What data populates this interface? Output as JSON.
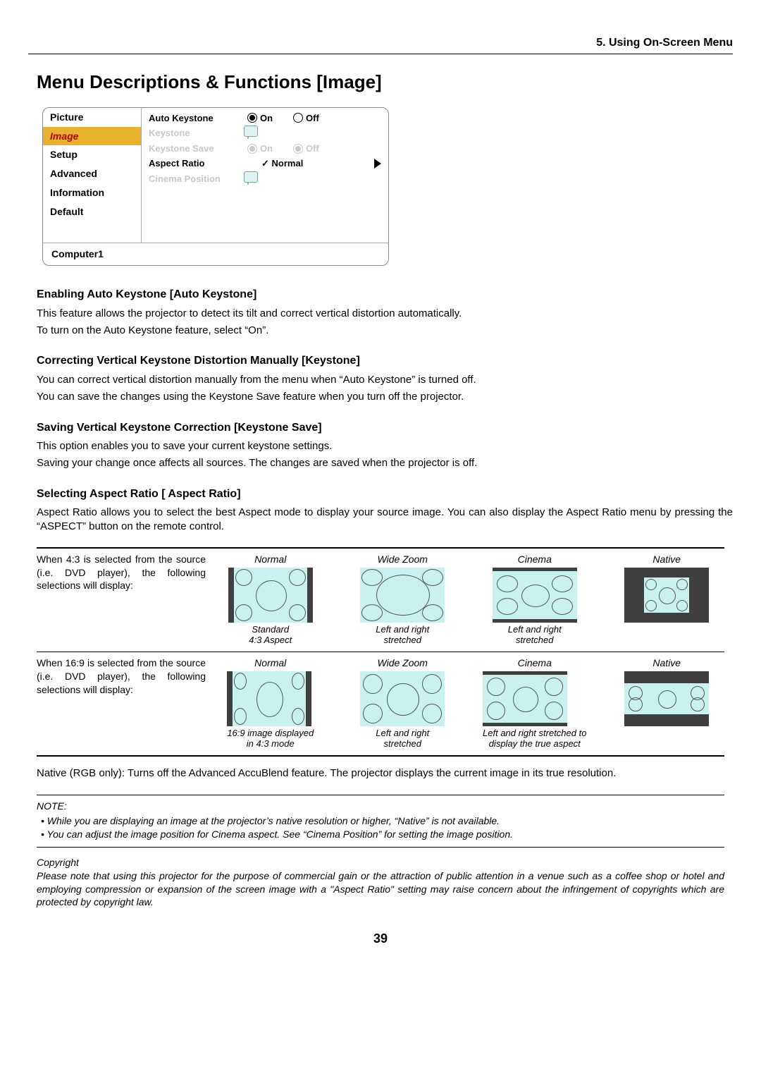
{
  "chapter": "5. Using On-Screen Menu",
  "title": "Menu Descriptions & Functions [Image]",
  "osd": {
    "left": [
      "Picture",
      "Image",
      "Setup",
      "Advanced",
      "Information",
      "Default"
    ],
    "rows": {
      "autokeystone": {
        "label": "Auto Keystone",
        "on": "On",
        "off": "Off"
      },
      "keystone": {
        "label": "Keystone"
      },
      "keystonesave": {
        "label": "Keystone Save",
        "on": "On",
        "off": "Off"
      },
      "aspect": {
        "label": "Aspect Ratio",
        "value": "Normal"
      },
      "cinemapos": {
        "label": "Cinema Position"
      }
    },
    "status": "Computer1"
  },
  "sec1": {
    "h": "Enabling Auto Keystone [Auto Keystone]",
    "p1": "This feature allows the projector to detect its tilt and correct vertical distortion automatically.",
    "p2": "To turn on the Auto Keystone feature, select “On”."
  },
  "sec2": {
    "h": "Correcting Vertical Keystone Distortion Manually [Keystone]",
    "p1": "You can correct vertical distortion manually from the menu when “Auto Keystone” is turned off.",
    "p2": "You can save the changes using the Keystone Save feature when you turn off the projector."
  },
  "sec3": {
    "h": "Saving Vertical Keystone Correction [Keystone Save]",
    "p1": "This option enables you to save your current keystone settings.",
    "p2": "Saving your change once affects all sources. The changes are saved when the projector is off."
  },
  "sec4": {
    "h": "Selecting Aspect Ratio [ Aspect Ratio]",
    "p1": "Aspect Ratio allows you to select the best Aspect mode to display your source image. You can also display the Aspect Ratio menu by pressing the “ASPECT” button on the remote control."
  },
  "ar": {
    "row1Label": "When 4:3 is selected from the source (i.e. DVD player), the following selections will display:",
    "row2Label": "When 16:9 is selected from the source (i.e. DVD player), the following selections will display:",
    "heads": {
      "normal": "Normal",
      "wide": "Wide Zoom",
      "cinema": "Cinema",
      "native": "Native"
    },
    "subs1": {
      "normal": "Standard\n4:3 Aspect",
      "wide": "Left and right\nstretched",
      "cinema": "Left and right\nstretched",
      "native": ""
    },
    "subs2": {
      "normal": "16:9 image displayed\nin 4:3 mode",
      "wide": "Left and right\nstretched",
      "cinema": "Left and right stretched to\ndisplay the true aspect",
      "native": ""
    }
  },
  "nativeNote": "Native (RGB only): Turns off the Advanced AccuBlend feature. The projector displays the current image in its true resolution.",
  "note": {
    "title": "NOTE:",
    "b1": "While you are displaying an image at the projector’s native resolution or higher, “Native” is not available.",
    "b2": "You can adjust the image position for Cinema aspect. See “Cinema Position” for setting the image position."
  },
  "copyright": {
    "h": "Copyright",
    "p": "Please note that using this projector for the purpose of commercial gain or the attraction of public attention in a venue such as a coffee shop or hotel and employing compression or expansion of the screen image with a \"Aspect Ratio\" setting may raise concern about the infringement of copyrights which are protected by copyright law."
  },
  "pageNum": "39"
}
